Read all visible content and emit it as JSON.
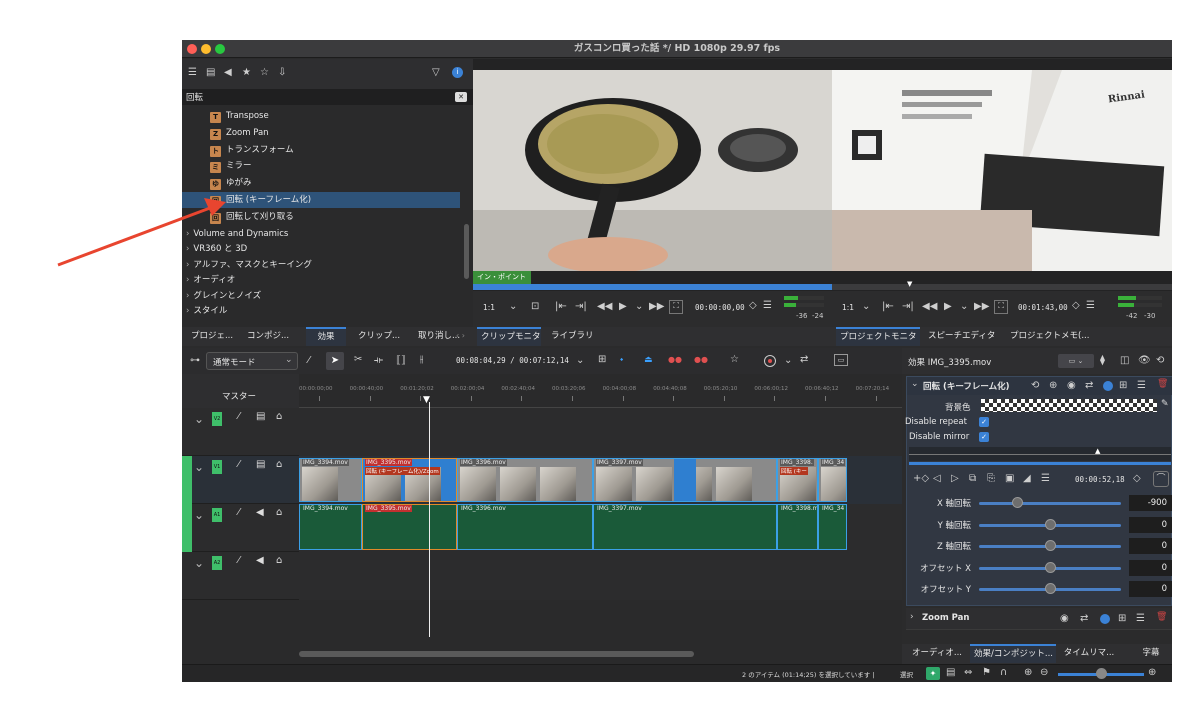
{
  "window": {
    "title": "ガスコンロ買った話 */ HD 1080p 29.97 fps"
  },
  "effects_panel": {
    "search_text": "回転",
    "items": [
      {
        "badge": "T",
        "label": "Transpose"
      },
      {
        "badge": "Z",
        "label": "Zoom Pan"
      },
      {
        "badge": "ト",
        "label": "トランスフォーム"
      },
      {
        "badge": "ミ",
        "label": "ミラー"
      },
      {
        "badge": "ゆ",
        "label": "ゆがみ"
      },
      {
        "badge": "回",
        "label": "回転 (キーフレーム化)"
      },
      {
        "badge": "回",
        "label": "回転して刈り取る"
      }
    ],
    "categories": [
      "Volume and Dynamics",
      "VR360 と 3D",
      "アルファ、マスクとキーイング",
      "オーディオ",
      "グレインとノイズ",
      "スタイル"
    ]
  },
  "left_tabs": [
    "プロジェ...",
    "コンポジ...",
    "効果",
    "クリップ...",
    "取り消し..."
  ],
  "clip_monitor": {
    "in_point_label": "イン・ポイント",
    "zoom": "1:1",
    "timecode": "00:00:00,00"
  },
  "project_monitor": {
    "zoom": "1:1",
    "timecode": "00:01:43,00",
    "meter_left": [
      "-36",
      "-24"
    ],
    "meter_right": [
      "-42",
      "-30"
    ],
    "photo_brand": "Rinnai"
  },
  "monitor_tabs_left": [
    "クリップモニタ",
    "ライブラリ"
  ],
  "monitor_tabs_right": [
    "プロジェクトモニタ",
    "スピーチエディタ",
    "プロジェクトメモ(..."
  ],
  "timeline_toolbar": {
    "mode": "通常モード",
    "timecode": "00:08:04,29 / 00:07:12,14"
  },
  "timeline": {
    "master_label": "マスター",
    "ruler": [
      "00:00:00;00",
      "00:00:40;00",
      "00:01:20;02",
      "00:02:00;04",
      "00:02:40;04",
      "00:03:20;06",
      "00:04:00;08",
      "00:04:40;08",
      "00:05:20;10",
      "00:06:00;12",
      "00:06:40;12",
      "00:07:20;14"
    ],
    "tracks": [
      "V2",
      "V1",
      "A1",
      "A2"
    ],
    "video_clips": [
      {
        "name": "IMG_3394.mov",
        "effect": ""
      },
      {
        "name": "IMG_3395.mov",
        "effect": "回転 (キーフレーム化)/Zoom"
      },
      {
        "name": "IMG_3396.mov",
        "effect": ""
      },
      {
        "name": "IMG_3397.mov",
        "effect": ""
      },
      {
        "name": "IMG_3398.",
        "effect": "回転 (キー"
      },
      {
        "name": "IMG_34",
        "effect": ""
      }
    ],
    "audio_clips": [
      "IMG_3394.mov",
      "IMG_3395.mov",
      "IMG_3396.mov",
      "IMG_3397.mov",
      "IMG_3398.m",
      "IMG_34"
    ]
  },
  "effect_stack": {
    "title": "効果 IMG_3395.mov",
    "effect_name": "回転 (キーフレーム化)",
    "bg_label": "背景色",
    "disable_repeat": "Disable repeat",
    "disable_mirror": "Disable mirror",
    "kf_timecode": "00:00:52,18",
    "params": [
      {
        "label": "X 軸回転",
        "value": "-900",
        "pos": 0.27
      },
      {
        "label": "Y 軸回転",
        "value": "0",
        "pos": 0.5
      },
      {
        "label": "Z 軸回転",
        "value": "0",
        "pos": 0.5
      },
      {
        "label": "オフセット X",
        "value": "0",
        "pos": 0.5
      },
      {
        "label": "オフセット Y",
        "value": "0",
        "pos": 0.5
      }
    ],
    "second_effect": "Zoom Pan"
  },
  "bottom_tabs": [
    "オーディオ...",
    "効果/コンポジット...",
    "タイムリマ...",
    "字幕"
  ],
  "status": {
    "selection": "2 のアイテム (01:14;25) を選択しています |",
    "select_label": "選択"
  }
}
